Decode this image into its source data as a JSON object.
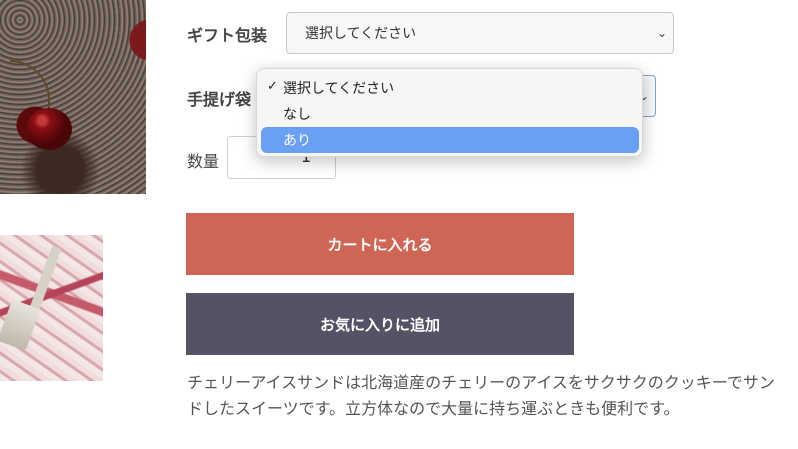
{
  "gift_wrap": {
    "label": "ギフト包装",
    "value": "選択してください"
  },
  "bag": {
    "label": "手提げ袋",
    "chevron": "chevron-down-icon",
    "options": [
      {
        "label": "選択してください",
        "checked": true
      },
      {
        "label": "なし"
      },
      {
        "label": "あり",
        "highlighted": true
      }
    ]
  },
  "quantity": {
    "label": "数量",
    "value": "1"
  },
  "buttons": {
    "add_to_cart": "カートに入れる",
    "add_to_favorites": "お気に入りに追加"
  },
  "description": "チェリーアイスサンドは北海道産のチェリーのアイスをサクサクのクッキーでサンドしたスイーツです。立方体なので大量に持ち運ぶときも便利です。",
  "colors": {
    "cart_button": "#cf6555",
    "favorite_button": "#545264",
    "highlight": "#6aa0f4"
  }
}
